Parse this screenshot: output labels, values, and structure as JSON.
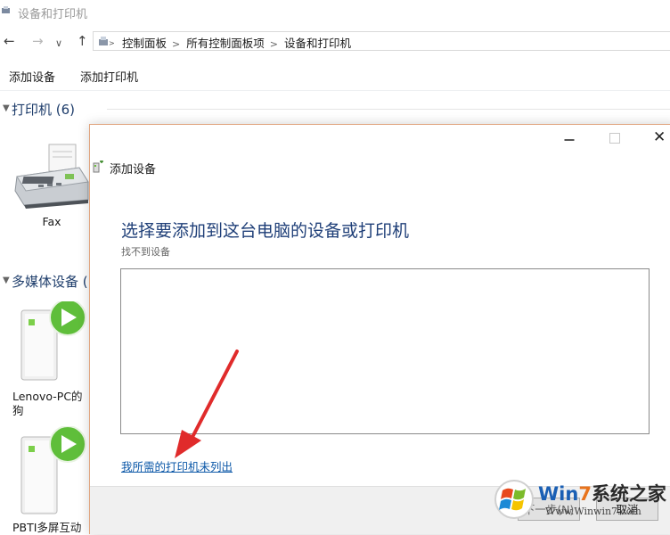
{
  "window": {
    "title": "设备和打印机"
  },
  "nav": {
    "back": "←",
    "forward": "→",
    "recent": "∨",
    "up": "↑",
    "crumbs": [
      "控制面板",
      "所有控制面板项",
      "设备和打印机"
    ],
    "crumb_sep": ">"
  },
  "toolbar": {
    "add_device": "添加设备",
    "add_printer": "添加打印机"
  },
  "groups": {
    "printers": {
      "title": "打印机 (6)"
    },
    "media": {
      "title": "多媒体设备 ("
    }
  },
  "devices": {
    "fax": "Fax",
    "lenovo_line1": "Lenovo-PC的",
    "lenovo_line2": "狗",
    "pbti": "PBTI多屏互动"
  },
  "dialog": {
    "title": "添加设备",
    "heading": "选择要添加到这台电脑的设备或打印机",
    "subheading": "找不到设备",
    "link": "我所需的打印机未列出",
    "next_button": "下一步(N)",
    "cancel_button": "取消",
    "close": "✕"
  },
  "watermark": {
    "brand_win": "Win",
    "brand_7": "7",
    "brand_rest": "系统之家",
    "url": "Www.Winwin7.com"
  },
  "colors": {
    "accent_heading": "#1f3f78",
    "link": "#0c58a8",
    "arrow": "#e02b2b",
    "dialog_border": "#e0a47e"
  }
}
